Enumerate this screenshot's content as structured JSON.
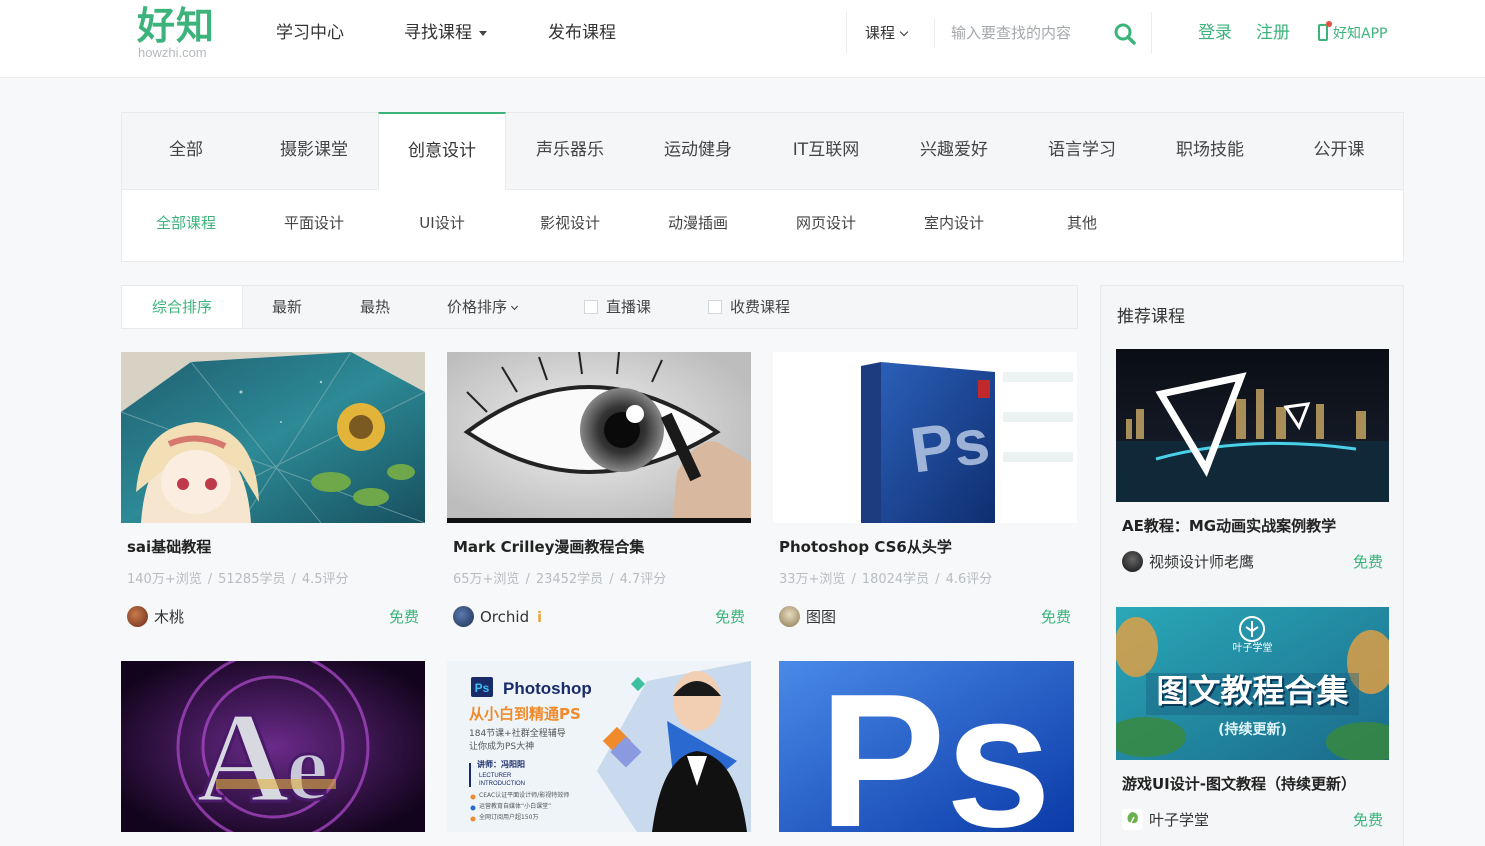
{
  "header": {
    "logo": "好知",
    "logo_sub": "howzhi.com",
    "nav": [
      "学习中心",
      "寻找课程",
      "发布课程"
    ],
    "search_type": "课程",
    "search_placeholder": "输入要查找的内容",
    "login": "登录",
    "register": "注册",
    "app": "好知APP"
  },
  "categories": {
    "tabs": [
      "全部",
      "摄影课堂",
      "创意设计",
      "声乐器乐",
      "运动健身",
      "IT互联网",
      "兴趣爱好",
      "语言学习",
      "职场技能",
      "公开课"
    ],
    "active_tab": "创意设计",
    "sub_tabs": [
      "全部课程",
      "平面设计",
      "UI设计",
      "影视设计",
      "动漫插画",
      "网页设计",
      "室内设计",
      "其他"
    ],
    "active_sub": "全部课程"
  },
  "sort": {
    "items": [
      "综合排序",
      "最新",
      "最热",
      "价格排序"
    ],
    "checkboxes": [
      "直播课",
      "收费课程"
    ]
  },
  "courses": [
    {
      "title": "sai基础教程",
      "views": "140万+浏览",
      "students": "51285学员",
      "rating": "4.5评分",
      "author": "木桃",
      "price": "免费",
      "thumb": "anime-girl-umbrella"
    },
    {
      "title": "Mark Crilley漫画教程合集",
      "views": "65万+浏览",
      "students": "23452学员",
      "rating": "4.7评分",
      "author": "Orchid",
      "badge": "i",
      "price": "免费",
      "thumb": "eye-drawing"
    },
    {
      "title": "Photoshop CS6从头学",
      "views": "33万+浏览",
      "students": "18024学员",
      "rating": "4.6评分",
      "author": "图图",
      "price": "免费",
      "thumb": "photoshop-box"
    },
    {
      "title": "",
      "thumb": "after-effects-logo"
    },
    {
      "title": "",
      "thumb": "photoshop-banner",
      "banner_title": "Photoshop",
      "banner_sub": "从小白到精通PS",
      "banner_line1": "184节课+社群全程辅导",
      "banner_line2": "让你成为PS大神",
      "banner_teacher": "讲师：冯阳阳",
      "banner_en1": "LECTURER",
      "banner_en2": "INTRODUCTION",
      "banner_b1": "CEAC认证平面设计师/影视特效师",
      "banner_b2": "运营教育自媒体“小白课堂”",
      "banner_b3": "全网订阅用户超150万"
    },
    {
      "title": "",
      "thumb": "ps-logo-large"
    }
  ],
  "sidebar": {
    "title": "推荐课程",
    "items": [
      {
        "title": "AE教程：MG动画实战案例教学",
        "author": "视频设计师老鹰",
        "price": "免费",
        "thumb": "night-city-triangle"
      },
      {
        "title": "游戏UI设计-图文教程（持续更新）",
        "author": "叶子学堂",
        "price": "免费",
        "thumb": "game-ui-banner",
        "banner_brand": "叶子学堂",
        "banner_title": "图文教程合集",
        "banner_sub": "(持续更新)"
      }
    ]
  },
  "colors": {
    "accent": "#3db37c",
    "text": "#333333",
    "muted": "#b8bcc0"
  }
}
